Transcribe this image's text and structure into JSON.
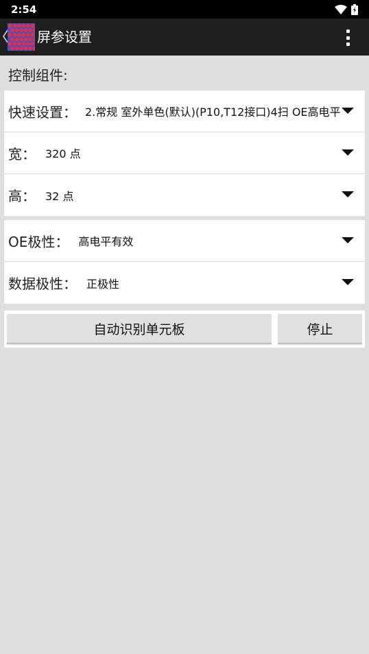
{
  "status_bar": {
    "time": "2:54"
  },
  "app_bar": {
    "title": "屏参设置"
  },
  "section": {
    "label": "控制组件:"
  },
  "settings": {
    "quick": {
      "label": "快速设置：",
      "value": "2.常规 室外单色(默认)(P10,T12接口)4扫 OE高电平"
    },
    "width": {
      "label": "宽：",
      "value": "320 点"
    },
    "height": {
      "label": "高：",
      "value": "32 点"
    },
    "oe_polarity": {
      "label": "OE极性：",
      "value": "高电平有效"
    },
    "data_polarity": {
      "label": "数据极性：",
      "value": "正极性"
    }
  },
  "buttons": {
    "auto_detect": "自动识别单元板",
    "stop": "停止"
  },
  "colors": {
    "logo_red": "#e5303a",
    "logo_blue": "#3b52d9",
    "app_bar": "#1f1f1f",
    "background": "#dedede"
  }
}
